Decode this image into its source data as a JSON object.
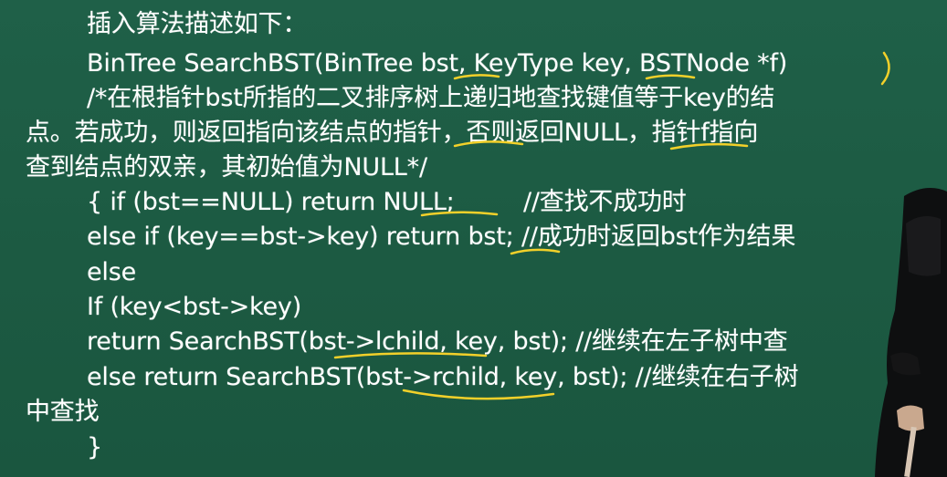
{
  "lines": [
    "插入算法描述如下：",
    "BinTree SearchBST(BinTree bst, KeyType key, BSTNode *f)",
    "/*在根指针bst所指的二叉排序树上递归地查找键值等于key的结",
    "点。若成功，则返回指向该结点的指针，否则返回NULL，指针f指向",
    "查到结点的双亲，其初始值为NULL*/",
    "{ if (bst==NULL) return NULL;         //查找不成功时",
    "else if (key==bst->key) return bst; //成功时返回bst作为结果",
    "else",
    "If (key<bst->key)",
    "return SearchBST(bst->lchild, key, bst); //继续在左子树中查",
    "else return SearchBST(bst->rchild, key, bst); //继续在右子树",
    "中查找",
    "}"
  ],
  "colors": {
    "board": "#1d5c44",
    "text": "#ffffff",
    "annotation": "#f2d02a"
  }
}
